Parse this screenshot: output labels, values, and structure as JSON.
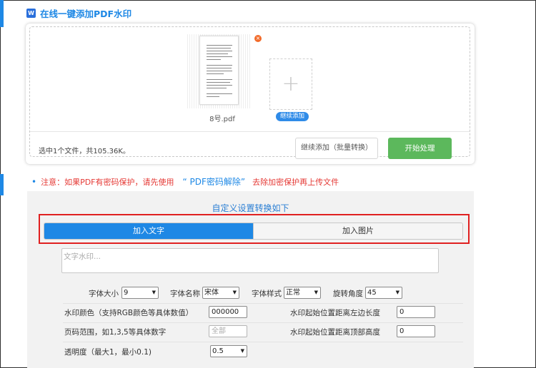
{
  "header": {
    "logo_letter": "W",
    "title": "在线一键添加PDF水印"
  },
  "upload": {
    "file_name": "8号.pdf",
    "remove_symbol": "×",
    "add_symbol": "+",
    "add_more_label": "继续添加",
    "summary": "选中1个文件，共105.36K。",
    "batch_add_label": "继续添加（批量转换）",
    "start_label": "开始处理"
  },
  "notice": {
    "prefix": "注意：如果PDF有密码保护，请先使用",
    "link": "“ PDF密码解除”",
    "suffix": "去除加密保护再上传文件"
  },
  "settings": {
    "title": "自定义设置转换如下",
    "tabs": [
      {
        "label": "加入文字",
        "active": true
      },
      {
        "label": "加入图片",
        "active": false
      }
    ],
    "text_placeholder": "文字水印...",
    "font_size_label": "字体大小",
    "font_size_value": "9",
    "font_name_label": "字体名称",
    "font_name_value": "宋体",
    "font_style_label": "字体样式",
    "font_style_value": "正常",
    "rotation_label": "旋转角度",
    "rotation_value": "45",
    "color_label": "水印颜色（支持RGB颜色等具体数值）",
    "color_value": "000000",
    "left_offset_label": "水印起始位置距离左边长度",
    "left_offset_value": "0",
    "page_range_label": "页码范围，如1,3,5等具体数字",
    "page_range_placeholder": "全部",
    "top_offset_label": "水印起始位置距离顶部高度",
    "top_offset_value": "0",
    "opacity_label": "透明度（最大1，最小0.1)",
    "opacity_value": "0.5"
  },
  "colors": {
    "accent": "#1e88e5",
    "start_button": "#5cb85c",
    "warning": "#e53935",
    "remove": "#f26b2a"
  },
  "icons": {
    "dropdown": "chevron-down-icon",
    "remove": "close-icon",
    "add": "plus-icon",
    "logo": "word-icon"
  }
}
